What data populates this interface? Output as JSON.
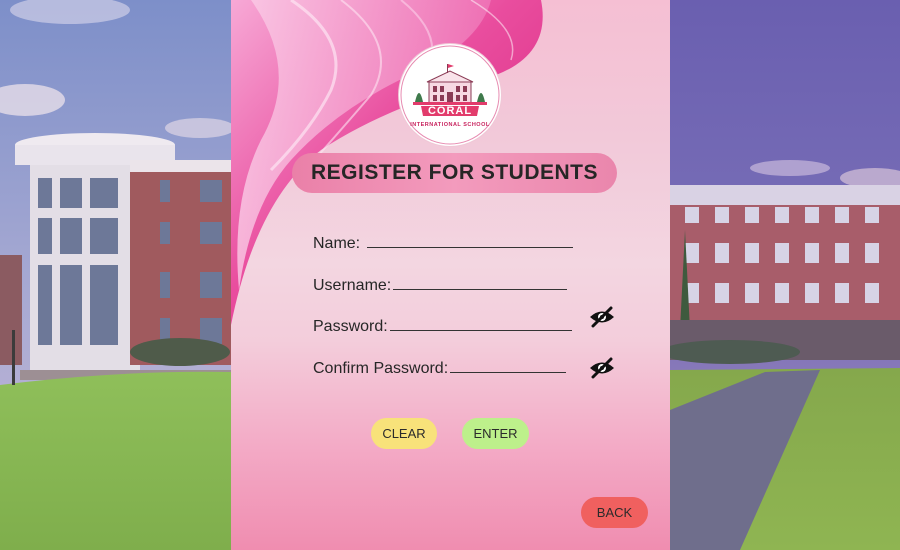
{
  "logo": {
    "name": "CORAL",
    "subtitle": "INTERNATIONAL SCHOOL"
  },
  "form": {
    "title": "REGISTER FOR STUDENTS",
    "fields": {
      "name": "Name: ",
      "username": "Username:",
      "password": "Password:",
      "confirm_password": "Confirm Password:"
    }
  },
  "buttons": {
    "clear": "CLEAR",
    "enter": "ENTER",
    "back": "BACK"
  },
  "icons": {
    "password_toggle": "eye-slash-icon",
    "confirm_toggle": "eye-slash-icon"
  },
  "colors": {
    "title_pill": "#ef8fb4",
    "clear_button": "#f8e27a",
    "enter_button": "#bdf08b",
    "back_button": "#f0605f",
    "panel_pink": "#f3cddb"
  }
}
